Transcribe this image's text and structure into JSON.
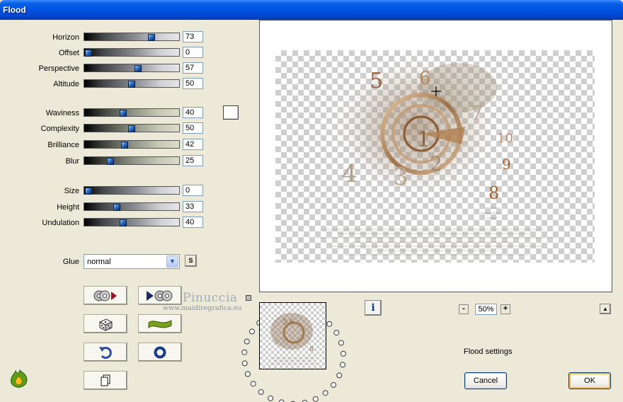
{
  "window": {
    "title": "Flood"
  },
  "params": [
    {
      "label": "Horizon",
      "value": "73",
      "frac": 0.73,
      "style": "gray"
    },
    {
      "label": "Offset",
      "value": "0",
      "frac": 0.0,
      "style": "gray"
    },
    {
      "label": "Perspective",
      "value": "57",
      "frac": 0.57,
      "style": "gray"
    },
    {
      "label": "Altitude",
      "value": "50",
      "frac": 0.5,
      "style": "gray"
    },
    {
      "label": "Waviness",
      "value": "40",
      "frac": 0.4,
      "style": "beige"
    },
    {
      "label": "Complexity",
      "value": "50",
      "frac": 0.5,
      "style": "beige"
    },
    {
      "label": "Brilliance",
      "value": "42",
      "frac": 0.42,
      "style": "beige"
    },
    {
      "label": "Blur",
      "value": "25",
      "frac": 0.25,
      "style": "beige"
    },
    {
      "label": "Size",
      "value": "0",
      "frac": 0.0,
      "style": "gray"
    },
    {
      "label": "Height",
      "value": "33",
      "frac": 0.33,
      "style": "gray"
    },
    {
      "label": "Undulation",
      "value": "40",
      "frac": 0.4,
      "style": "gray"
    }
  ],
  "glue": {
    "label": "Glue",
    "value": "normal",
    "s_button": "S"
  },
  "watermark": {
    "name": "Pinuccia",
    "url": "www.maidiregrafica.eu"
  },
  "zoom": {
    "minus": "-",
    "value": "50%",
    "plus": "+"
  },
  "info_button": "i",
  "status": "Flood settings",
  "buttons": {
    "cancel": "Cancel",
    "ok": "OK"
  },
  "colors": {
    "titlebar": "#0054e3",
    "slider_thumb": "#2f6fbf",
    "ok_focus": "#f9b94e"
  }
}
